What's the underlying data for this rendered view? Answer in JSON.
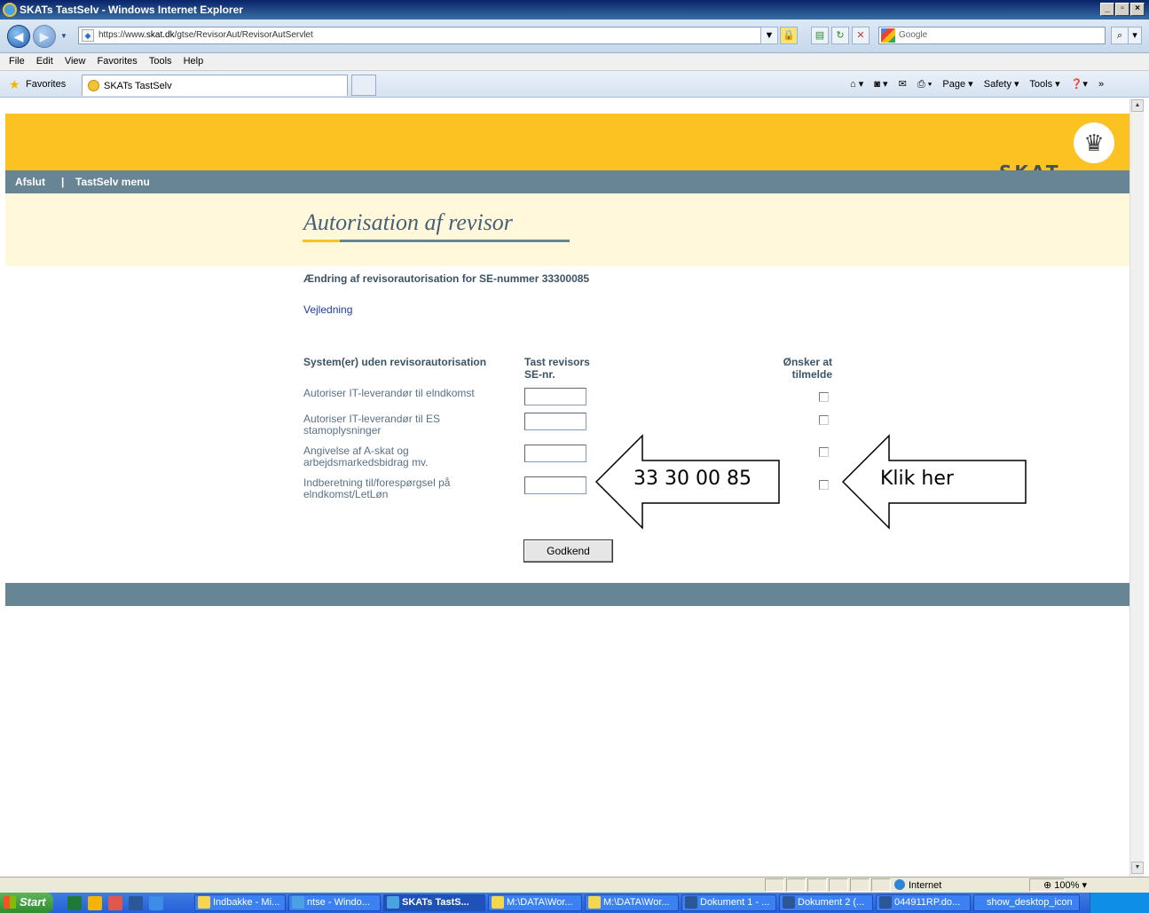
{
  "window": {
    "title": "SKATs TastSelv - Windows Internet Explorer"
  },
  "address": {
    "url_prefix": "https://www.",
    "url_domain": "skat.dk",
    "url_path": "/gtse/RevisorAut/RevisorAutServlet",
    "search_placeholder": "Google"
  },
  "menu": {
    "items": [
      "File",
      "Edit",
      "View",
      "Favorites",
      "Tools",
      "Help"
    ]
  },
  "favorites": {
    "label": "Favorites",
    "tab_title": "SKATs TastSelv",
    "commands": [
      "Page ▾",
      "Safety ▾",
      "Tools ▾"
    ]
  },
  "site": {
    "logo": "SKAT",
    "nav_exit": "Afslut",
    "nav_sep": "|",
    "nav_menu": "TastSelv menu",
    "page_title": "Autorisation af revisor",
    "subtitle": "Ændring af revisorautorisation for SE-nummer 33300085",
    "help_link": "Vejledning"
  },
  "form": {
    "col_system": "System(er) uden revisorautorisation",
    "col_se_line1": "Tast revisors",
    "col_se_line2": "SE-nr.",
    "col_signup_line1": "Ønsker at",
    "col_signup_line2": "tilmelde",
    "rows": [
      {
        "label_line1": "Autoriser IT-leverandør til elndkomst",
        "label_line2": "",
        "se_value": "",
        "checked": false
      },
      {
        "label_line1": "Autoriser IT-leverandør til ES",
        "label_line2": "stamoplysninger",
        "se_value": "",
        "checked": false
      },
      {
        "label_line1": "Angivelse af A-skat og",
        "label_line2": "arbejdsmarkedsbidrag mv.",
        "se_value": "",
        "checked": false
      },
      {
        "label_line1": "Indberetning til/forespørgsel på",
        "label_line2": "elndkomst/LetLøn",
        "se_value": "",
        "checked": false
      }
    ],
    "submit_label": "Godkend"
  },
  "annotations": {
    "arrow1_text": "33 30 00 85",
    "arrow2_text": "Klik her"
  },
  "statusbar": {
    "zone": "Internet",
    "zoom": "100%"
  },
  "taskbar": {
    "start": "Start",
    "buttons": [
      "Indbakke - Mi...",
      "ntse - Windo...",
      "SKATs TastS...",
      "M:\\DATA\\Wor...",
      "M:\\DATA\\Wor...",
      "Dokument 1 - ...",
      "Dokument 2 (...",
      "044911RP.do...",
      "show_desktop_icon"
    ]
  },
  "colors": {
    "brand_yellow": "#fcc221",
    "nav_blue_grey": "#678594",
    "header_cream": "#fff8db",
    "title_blue": "#46607a",
    "link_blue": "#1f3b9c"
  }
}
